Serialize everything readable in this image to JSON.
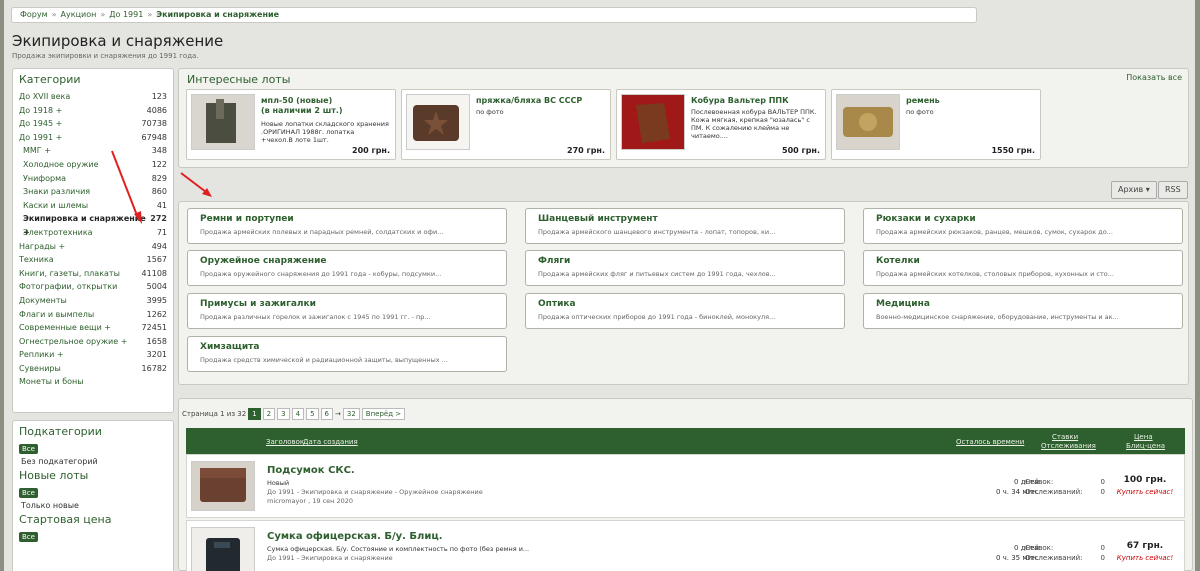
{
  "breadcrumb": {
    "items": [
      "Форум",
      "Аукцион",
      "До 1991"
    ],
    "current": "Экипировка и снаряжение",
    "sep": "»"
  },
  "page": {
    "title": "Экипировка и снаряжение",
    "subtitle": "Продажа экипировки и снаряжения до 1991 года."
  },
  "sidebar": {
    "categories_title": "Категории",
    "categories": [
      {
        "label": "До XVII века",
        "count": "123"
      },
      {
        "label": "До 1918 +",
        "count": "4086"
      },
      {
        "label": "До 1945 +",
        "count": "70738"
      },
      {
        "label": "До 1991 +",
        "count": "67948"
      },
      {
        "label": "ММГ +",
        "count": "348"
      },
      {
        "label": "Холодное оружие",
        "count": "122"
      },
      {
        "label": "Униформа",
        "count": "829"
      },
      {
        "label": "Знаки различия",
        "count": "860"
      },
      {
        "label": "Каски и шлемы",
        "count": "41"
      },
      {
        "label": "Экипировка и снаряжение +",
        "count": "272"
      },
      {
        "label": "Электротехника",
        "count": "71"
      },
      {
        "label": "Награды +",
        "count": "494"
      },
      {
        "label": "Техника",
        "count": "1567"
      },
      {
        "label": "Книги, газеты, плакаты",
        "count": "41108"
      },
      {
        "label": "Фотографии, открытки",
        "count": "5004"
      },
      {
        "label": "Документы",
        "count": "3995"
      },
      {
        "label": "Флаги и вымпелы",
        "count": "1262"
      },
      {
        "label": "Современные вещи +",
        "count": "72451"
      },
      {
        "label": "Огнестрельное оружие +",
        "count": "1658"
      },
      {
        "label": "Реплики +",
        "count": "3201"
      },
      {
        "label": "Сувениры",
        "count": "16782"
      },
      {
        "label": "Монеты и боны",
        "count": ""
      }
    ],
    "filters": [
      {
        "title": "Подкатегории",
        "all": "Все",
        "link": "Без подкатегорий"
      },
      {
        "title": "Новые лоты",
        "all": "Все",
        "link": "Только новые"
      },
      {
        "title": "Стартовая цена",
        "all": "Все",
        "link": ""
      }
    ]
  },
  "lots": {
    "title": "Интересные лоты",
    "show_all": "Показать все",
    "items": [
      {
        "title": "мпл-50 (новые)\n(в наличии 2 шт.)",
        "desc": "Новые лопатки складского хранения\n.ОРИГИНАЛ 1988г. лопатка\n+чехол.В лоте 1шт.",
        "price": "200 грн."
      },
      {
        "title": "пряжка/бляха ВС СССР",
        "desc": "по фото",
        "price": "270 грн."
      },
      {
        "title": "Кобура Вальтер ППК",
        "desc": "Послевоенная кобура ВАЛЬТЕР ППК.\nКожа мягкая, крепкая \"юзалась\" с\nПМ. К сожалению клейма не\nчитаемо....",
        "price": "500 грн."
      },
      {
        "title": "ремень",
        "desc": "по фото",
        "price": "1550 грн."
      }
    ]
  },
  "toolbar": {
    "archive": "Архив",
    "rss": "RSS"
  },
  "subcats": [
    {
      "name": "Ремни и портупеи",
      "desc": "Продажа армейских полевых и парадных ремней, солдатских и офи..."
    },
    {
      "name": "Шанцевый инструмент",
      "desc": "Продажа армейского шанцевого инструмента - лопат, топоров, ки..."
    },
    {
      "name": "Рюкзаки и сухарки",
      "desc": "Продажа армейских рюкзаков, ранцев, мешков, сумок, сухарок до..."
    },
    {
      "name": "Оружейное снаряжение",
      "desc": "Продажа оружейного снаряжения до 1991 года - кобуры, подсумки..."
    },
    {
      "name": "Фляги",
      "desc": "Продажа армейских фляг и питьевых систем до 1991 года, чехлов..."
    },
    {
      "name": "Котелки",
      "desc": "Продажа армейских котелков, столовых приборов, кухонных и сто..."
    },
    {
      "name": "Примусы и зажигалки",
      "desc": "Продажа различных горелок и зажигалок с 1945 по 1991 гг. - пр..."
    },
    {
      "name": "Оптика",
      "desc": "Продажа оптических приборов до 1991 года - биноклей, монокуля..."
    },
    {
      "name": "Медицина",
      "desc": "Военно-медицинское снаряжение, оборудование, инструменты и ак..."
    },
    {
      "name": "Химзащита",
      "desc": "Продажа средств химической и радиационной защиты, выпущенных ..."
    }
  ],
  "pager": {
    "label": "Страница 1 из 32",
    "pages": [
      "1",
      "2",
      "3",
      "4",
      "5",
      "6"
    ],
    "arrow": "→",
    "last": "32",
    "next": "Вперёд >"
  },
  "list": {
    "head": {
      "title": "Заголовок",
      "date": "Дата создания",
      "time_left": "Осталось времени",
      "bids": "Ставки",
      "watching": "Отслеживания",
      "price": "Цена",
      "blitz": "Блиц-цена"
    },
    "rows": [
      {
        "title": "Подсумок СКС.",
        "line1": "Новый",
        "line2": "До 1991 - Экипировка и снаряжение - Оружейное снаряжение",
        "line3": "micromayor , 19 сен 2020",
        "days": "0 дней",
        "time": "0 ч. 34 мин.",
        "bids_label": "Ставок:",
        "bids": "0",
        "watch_label": "Отслеживаний:",
        "watch": "0",
        "price": "100 грн.",
        "buy": "Купить сейчас!"
      },
      {
        "title": "Сумка офицерская. Б/у. Блиц.",
        "line1": "Сумка офицерская. Б/у. Состояние и комплектность по фото (без ремня и...",
        "line2": "До 1991 - Экипировка и снаряжение",
        "line3": "",
        "days": "0 дней",
        "time": "0 ч. 35 мин.",
        "bids_label": "Ставок:",
        "bids": "0",
        "watch_label": "Отслеживаний:",
        "watch": "0",
        "price": "67 грн.",
        "buy": "Купить сейчас!"
      }
    ]
  },
  "colors": {
    "accent": "#2e5f2e",
    "arrow": "#e02020",
    "buy": "#cc0000"
  }
}
